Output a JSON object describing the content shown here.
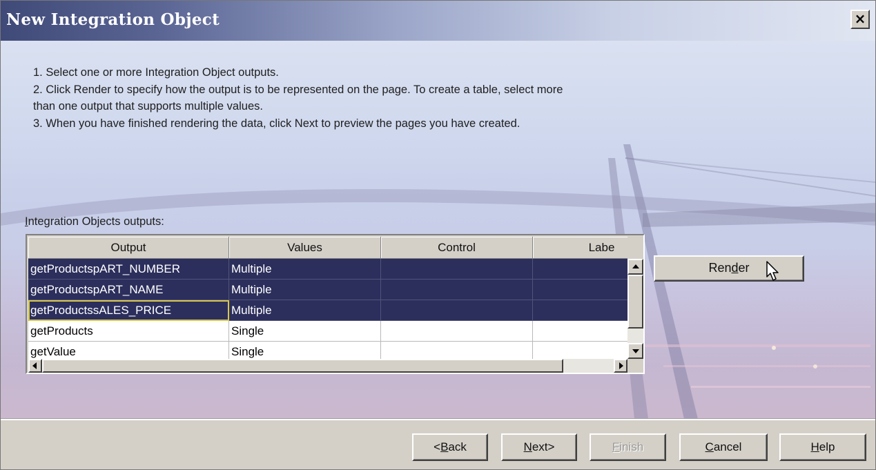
{
  "dialog": {
    "title": "New Integration Object",
    "close_label": "×"
  },
  "instructions": [
    "1. Select one or more Integration Object outputs.",
    "2. Click Render to specify how the output is to be represented on the page. To create a table, select more",
    "than one output that supports multiple values.",
    "3. When you have finished rendering the data, click Next to preview the pages you have created."
  ],
  "outputs_label": {
    "mnemonic": "I",
    "rest": "ntegration Objects outputs:"
  },
  "table": {
    "columns": [
      "Output",
      "Values",
      "Control",
      "Labe"
    ],
    "rows": [
      {
        "output": "getProductspART_NUMBER",
        "values": "Multiple",
        "control": "",
        "label": "",
        "selected": true
      },
      {
        "output": "getProductspART_NAME",
        "values": "Multiple",
        "control": "",
        "label": "",
        "selected": true
      },
      {
        "output": "getProductssALES_PRICE",
        "values": "Multiple",
        "control": "",
        "label": "",
        "selected": true,
        "focused": true
      },
      {
        "output": "getProducts",
        "values": "Single",
        "control": "",
        "label": "",
        "selected": false
      },
      {
        "output": "getValue",
        "values": "Single",
        "control": "",
        "label": "",
        "selected": false
      }
    ]
  },
  "render_button": {
    "pre": "Ren",
    "mnemonic": "d",
    "post": "er"
  },
  "footer_buttons": {
    "back": {
      "pre": "<",
      "mnemonic": "B",
      "post": "ack"
    },
    "next": {
      "pre": "",
      "mnemonic": "N",
      "post": "ext>"
    },
    "finish": {
      "pre": "",
      "mnemonic": "F",
      "post": "inish"
    },
    "cancel": {
      "pre": "",
      "mnemonic": "C",
      "post": "ancel"
    },
    "help": {
      "pre": "",
      "mnemonic": "H",
      "post": "elp"
    }
  },
  "colors": {
    "title_gradient_start": "#404a78",
    "selection": "#2c2f5c",
    "focus_outline": "#d8c84a",
    "dialog_gray": "#d4d0c8"
  }
}
